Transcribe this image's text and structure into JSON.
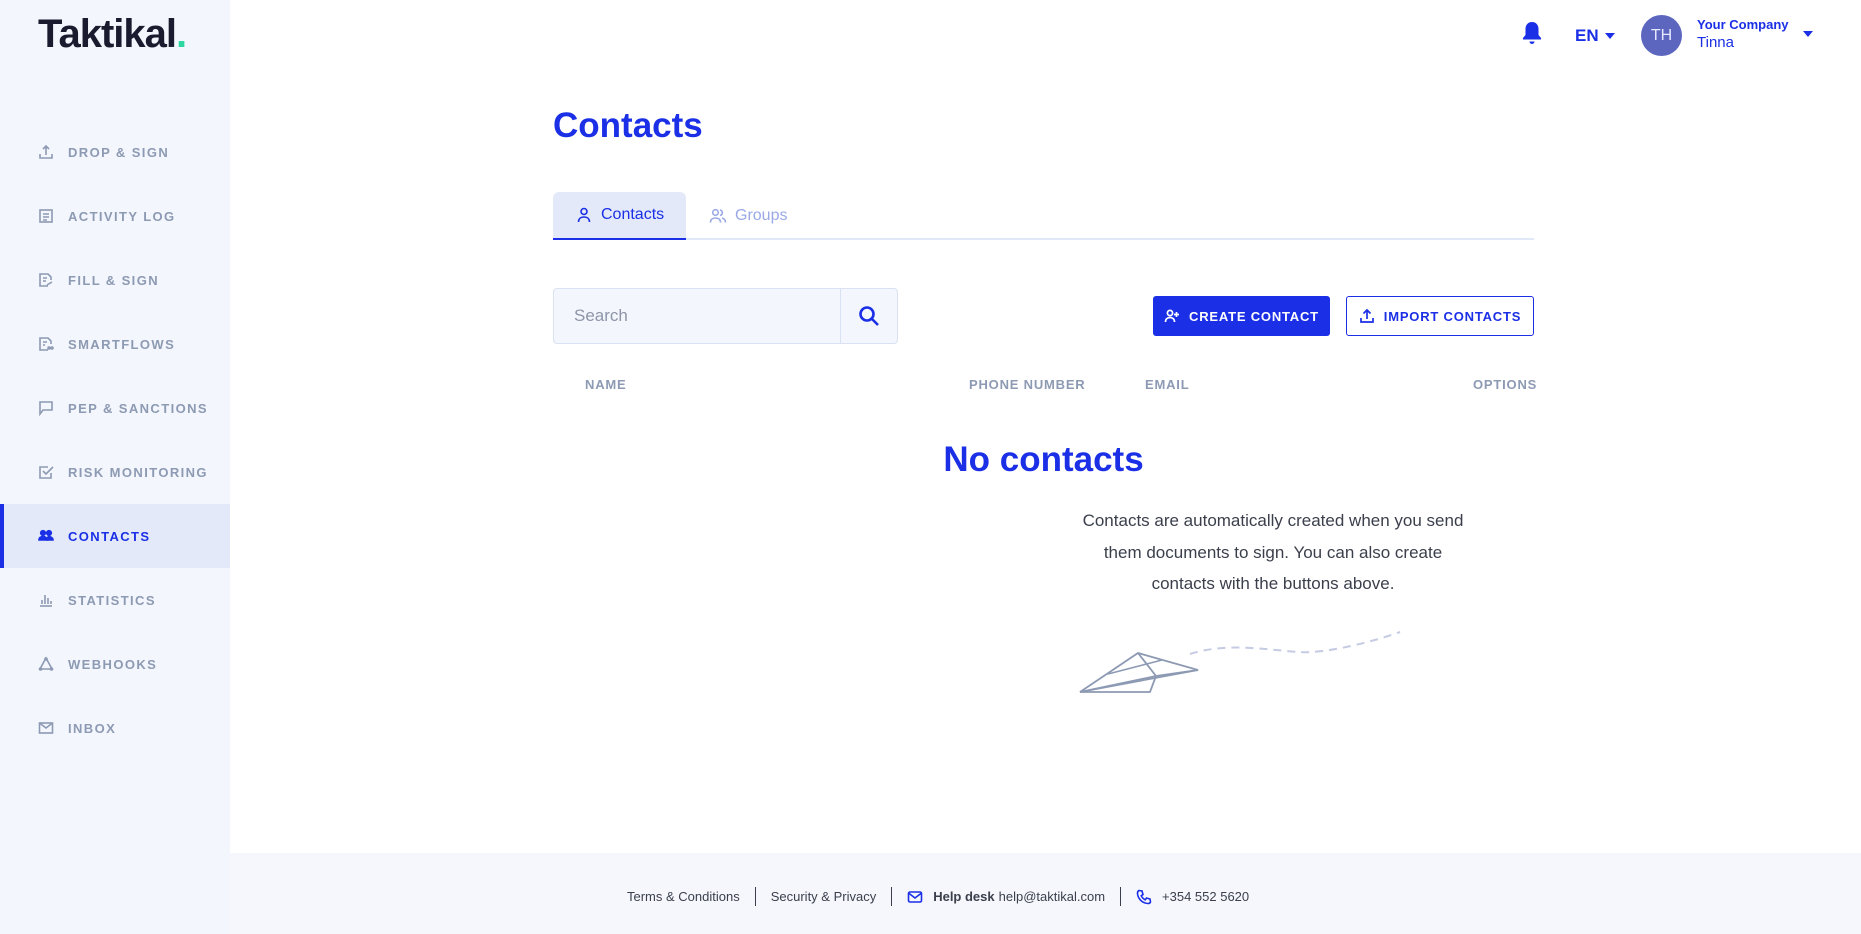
{
  "brand": {
    "logo_text": "Taktikal",
    "logo_dot": ".",
    "accent_color": "#1a2fe6",
    "dot_color": "#2bd9a0"
  },
  "sidebar": {
    "items": [
      {
        "label": "DROP & SIGN",
        "icon": "upload-icon"
      },
      {
        "label": "ACTIVITY LOG",
        "icon": "log-icon"
      },
      {
        "label": "FILL & SIGN",
        "icon": "fill-sign-icon"
      },
      {
        "label": "SMARTFLOWS",
        "icon": "smartflows-icon"
      },
      {
        "label": "PEP & SANCTIONS",
        "icon": "flag-icon"
      },
      {
        "label": "RISK MONITORING",
        "icon": "checkbox-icon"
      },
      {
        "label": "CONTACTS",
        "icon": "people-icon",
        "active": true
      },
      {
        "label": "STATISTICS",
        "icon": "bar-chart-icon"
      },
      {
        "label": "WEBHOOKS",
        "icon": "webhook-icon"
      },
      {
        "label": "INBOX",
        "icon": "mail-icon"
      }
    ]
  },
  "header": {
    "language": "EN",
    "avatar_initials": "TH",
    "company": "Your Company",
    "user": "Tinna"
  },
  "page": {
    "title": "Contacts",
    "tabs": [
      {
        "label": "Contacts",
        "active": true
      },
      {
        "label": "Groups",
        "active": false
      }
    ],
    "search_placeholder": "Search",
    "create_button": "CREATE CONTACT",
    "import_button": "IMPORT CONTACTS",
    "columns": [
      "NAME",
      "PHONE NUMBER",
      "EMAIL",
      "OPTIONS"
    ],
    "empty_title": "No contacts",
    "empty_text": "Contacts are automatically created when you send them documents to sign. You can also create contacts with the buttons above."
  },
  "footer": {
    "terms": "Terms & Conditions",
    "security": "Security & Privacy",
    "helpdesk_label": "Help desk",
    "helpdesk_email": "help@taktikal.com",
    "phone": "+354 552 5620"
  }
}
